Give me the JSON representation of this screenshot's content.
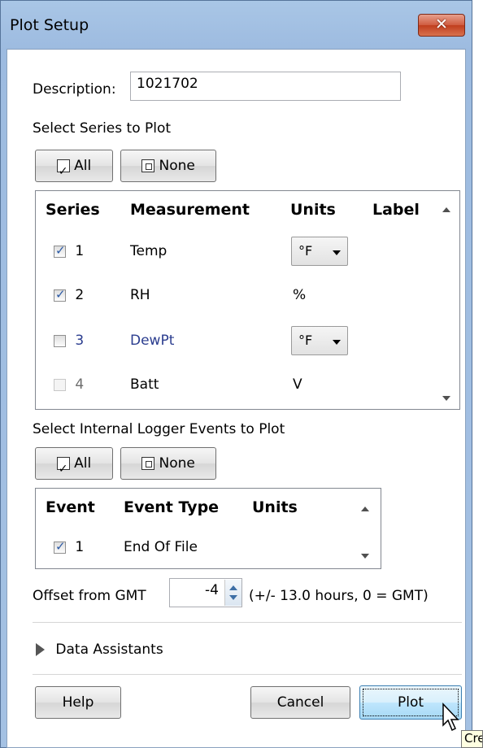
{
  "window": {
    "title": "Plot Setup",
    "close_label": "✕"
  },
  "description": {
    "label": "Description:",
    "value": "1021702"
  },
  "series_section": {
    "heading": "Select Series to Plot",
    "all_label": "All",
    "none_label": "None",
    "headers": {
      "series": "Series",
      "measurement": "Measurement",
      "units": "Units",
      "label": "Label"
    },
    "rows": [
      {
        "num": "1",
        "measurement": "Temp",
        "units": "°F",
        "checked": true
      },
      {
        "num": "2",
        "measurement": "RH",
        "units": "%",
        "checked": true
      },
      {
        "num": "3",
        "measurement": "DewPt",
        "units": "°F",
        "checked": false
      },
      {
        "num": "4",
        "measurement": "Batt",
        "units": "V",
        "checked": false
      }
    ]
  },
  "events_section": {
    "heading": "Select Internal Logger Events to Plot",
    "all_label": "All",
    "none_label": "None",
    "headers": {
      "event": "Event",
      "event_type": "Event Type",
      "units": "Units"
    },
    "rows": [
      {
        "num": "1",
        "event_type": "End Of File",
        "checked": true
      }
    ]
  },
  "offset": {
    "label": "Offset from GMT",
    "value": "-4",
    "hint": "(+/- 13.0 hours, 0 = GMT)"
  },
  "data_assistants": {
    "label": "Data Assistants"
  },
  "footer": {
    "help_label": "Help",
    "cancel_label": "Cancel",
    "plot_label": "Plot",
    "tooltip_fragment": "Cre"
  },
  "colors": {
    "accent_link": "#2b3d8f",
    "close_red": "#c8492a",
    "title_bar": "#a9c6e6"
  }
}
